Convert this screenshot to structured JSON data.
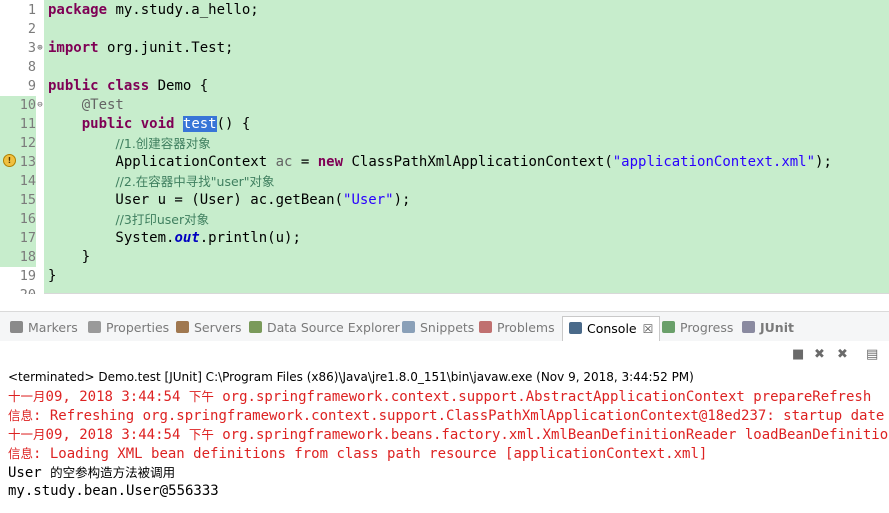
{
  "editor": {
    "lines": [
      {
        "n": "1",
        "parts": [
          {
            "t": "package",
            "c": "kw"
          },
          {
            "t": " my.study.a_hello;"
          }
        ]
      },
      {
        "n": "2",
        "parts": []
      },
      {
        "n": "3",
        "fold": "⊕",
        "parts": [
          {
            "t": "import",
            "c": "kw"
          },
          {
            "t": " org.junit.Test;"
          }
        ]
      },
      {
        "n": "8",
        "parts": []
      },
      {
        "n": "9",
        "parts": [
          {
            "t": "public",
            "c": "kw"
          },
          {
            "t": " "
          },
          {
            "t": "class",
            "c": "kw"
          },
          {
            "t": " Demo {"
          }
        ]
      },
      {
        "n": "10",
        "fold": "⊖",
        "hl": true,
        "parts": [
          {
            "t": "    "
          },
          {
            "t": "@Test",
            "c": "ann"
          }
        ]
      },
      {
        "n": "11",
        "hl": true,
        "parts": [
          {
            "t": "    "
          },
          {
            "t": "public",
            "c": "kw"
          },
          {
            "t": " "
          },
          {
            "t": "void",
            "c": "kw"
          },
          {
            "t": " "
          },
          {
            "t": "test",
            "c": "sel"
          },
          {
            "t": "() {"
          }
        ]
      },
      {
        "n": "12",
        "hl": true,
        "parts": [
          {
            "t": "        "
          },
          {
            "t": "//1.创建容器对象",
            "c": "cmt"
          }
        ]
      },
      {
        "n": "13",
        "hl": true,
        "parts": [
          {
            "t": "        ApplicationContext "
          },
          {
            "t": "ac",
            "c": "ann"
          },
          {
            "t": " = "
          },
          {
            "t": "new",
            "c": "kw"
          },
          {
            "t": " ClassPathXmlApplicationContext("
          },
          {
            "t": "\"applicationContext.xml\"",
            "c": "str"
          },
          {
            "t": ");"
          }
        ]
      },
      {
        "n": "14",
        "hl": true,
        "parts": [
          {
            "t": "        "
          },
          {
            "t": "//2.在容器中寻找\"user\"对象",
            "c": "cmt"
          }
        ]
      },
      {
        "n": "15",
        "hl": true,
        "parts": [
          {
            "t": "        User u = (User) ac.getBean("
          },
          {
            "t": "\"User\"",
            "c": "str"
          },
          {
            "t": ");"
          }
        ]
      },
      {
        "n": "16",
        "hl": true,
        "parts": [
          {
            "t": "        "
          },
          {
            "t": "//3打印user对象",
            "c": "cmt"
          }
        ]
      },
      {
        "n": "17",
        "hl": true,
        "parts": [
          {
            "t": "        System."
          },
          {
            "t": "out",
            "c": "fld"
          },
          {
            "t": ".println(u);"
          }
        ]
      },
      {
        "n": "18",
        "hl": true,
        "parts": [
          {
            "t": "    }"
          }
        ]
      },
      {
        "n": "19",
        "parts": [
          {
            "t": "}"
          }
        ]
      },
      {
        "n": "20",
        "parts": []
      }
    ]
  },
  "tabs": [
    {
      "label": "Markers",
      "name": "tab-markers",
      "icon": "markers-icon",
      "color": "#8a8a8a"
    },
    {
      "label": "Properties",
      "name": "tab-properties",
      "icon": "properties-icon",
      "color": "#9a9a9a"
    },
    {
      "label": "Servers",
      "name": "tab-servers",
      "icon": "servers-icon",
      "color": "#a07850"
    },
    {
      "label": "Data Source Explorer",
      "name": "tab-data-source-explorer",
      "icon": "database-icon",
      "color": "#7a9a5a"
    },
    {
      "label": "Snippets",
      "name": "tab-snippets",
      "icon": "snippets-icon",
      "color": "#8aa0b8"
    },
    {
      "label": "Problems",
      "name": "tab-problems",
      "icon": "problems-icon",
      "color": "#c07070"
    },
    {
      "label": "Console",
      "name": "tab-console",
      "icon": "console-icon",
      "color": "#4a6a8a",
      "active": true,
      "close": "☒"
    },
    {
      "label": "Progress",
      "name": "tab-progress",
      "icon": "progress-icon",
      "color": "#6aa06a"
    },
    {
      "label": "JUnit",
      "name": "tab-junit",
      "icon": "junit-icon",
      "color": "#8a8aa0",
      "bold": true
    }
  ],
  "toolbar": [
    {
      "name": "terminate-icon",
      "glyph": "■"
    },
    {
      "name": "remove-launch-icon",
      "glyph": "✖"
    },
    {
      "name": "remove-all-terminated-icon",
      "glyph": "✖"
    },
    {
      "name": "clear-console-icon",
      "glyph": "▤"
    }
  ],
  "console": {
    "status": "<terminated> Demo.test [JUnit] C:\\Program Files (x86)\\Java\\jre1.8.0_151\\bin\\javaw.exe (Nov 9, 2018, 3:44:52 PM)",
    "lines": [
      {
        "c": "err",
        "parts": [
          {
            "t": "十一月",
            "cn": true
          },
          {
            "t": "09, 2018 3:44:54 "
          },
          {
            "t": "下午",
            "cn": true
          },
          {
            "t": " org.springframework.context.support.AbstractApplicationContext prepareRefresh"
          }
        ]
      },
      {
        "c": "err",
        "parts": [
          {
            "t": "信息",
            "cn": true
          },
          {
            "t": ": Refreshing org.springframework.context.support.ClassPathXmlApplicationContext@18ed237: startup date"
          }
        ]
      },
      {
        "c": "err",
        "parts": [
          {
            "t": "十一月",
            "cn": true
          },
          {
            "t": "09, 2018 3:44:54 "
          },
          {
            "t": "下午",
            "cn": true
          },
          {
            "t": " org.springframework.beans.factory.xml.XmlBeanDefinitionReader loadBeanDefinitions"
          }
        ]
      },
      {
        "c": "err",
        "parts": [
          {
            "t": "信息",
            "cn": true
          },
          {
            "t": ": Loading XML bean definitions from class path resource [applicationContext.xml]"
          }
        ]
      },
      {
        "c": "out",
        "parts": [
          {
            "t": "User "
          },
          {
            "t": "的空参构造方法被调用",
            "cn": true
          }
        ]
      },
      {
        "c": "out",
        "parts": [
          {
            "t": "my.study.bean.User@556333"
          }
        ]
      }
    ]
  }
}
